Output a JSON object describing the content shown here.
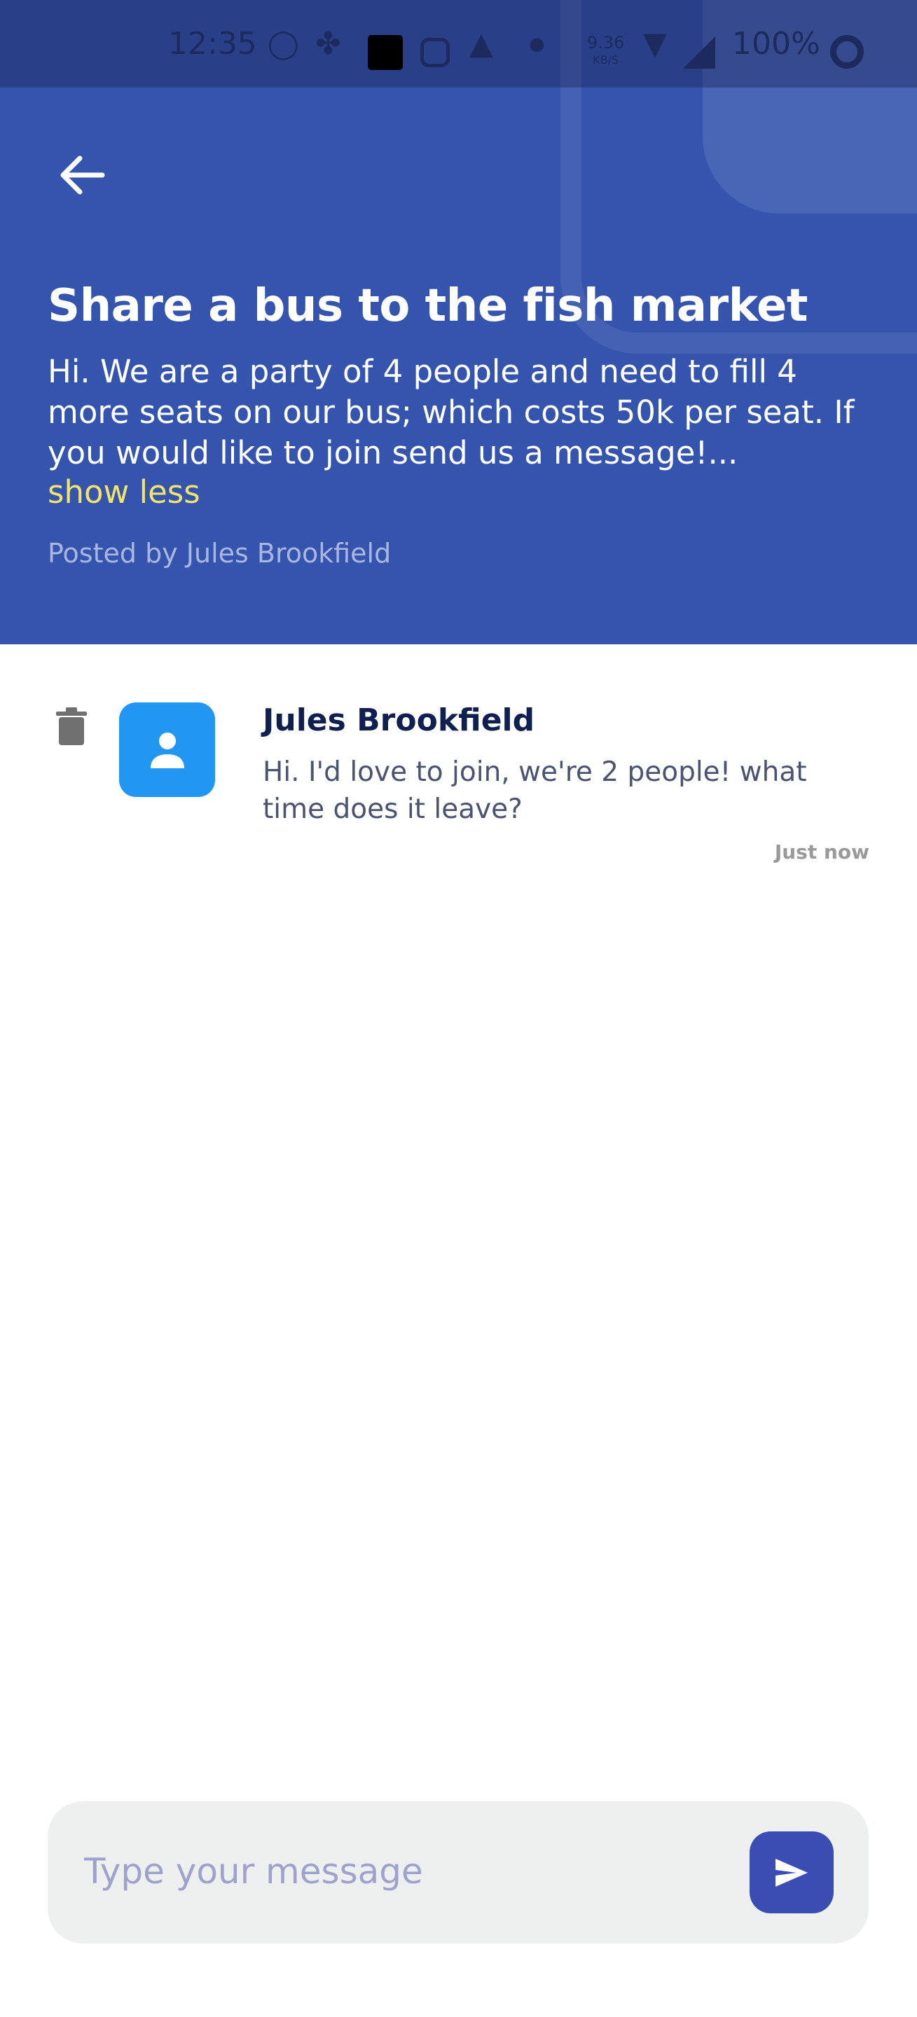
{
  "status_bar": {
    "time": "12:35",
    "net_speed": "9.36",
    "net_unit": "KB/S",
    "battery": "100%"
  },
  "header": {
    "title": "Share a bus to the fish market",
    "description": "Hi.  We are a party of 4 people and need to fill 4 more seats on our bus; which costs 50k per seat. If you would like to join send us a message!...",
    "toggle_label": "show less",
    "posted_by": "Posted by Jules Brookfield"
  },
  "messages": [
    {
      "author": "Jules Brookfield",
      "text": "Hi.  I'd love to join, we're 2 people!  what time does it leave?",
      "time": "Just now"
    }
  ],
  "composer": {
    "placeholder": "Type your message",
    "value": ""
  },
  "colors": {
    "header": "#3554ad",
    "accent": "#f2e36a",
    "avatar": "#2196f3",
    "send": "#3a4db3"
  }
}
